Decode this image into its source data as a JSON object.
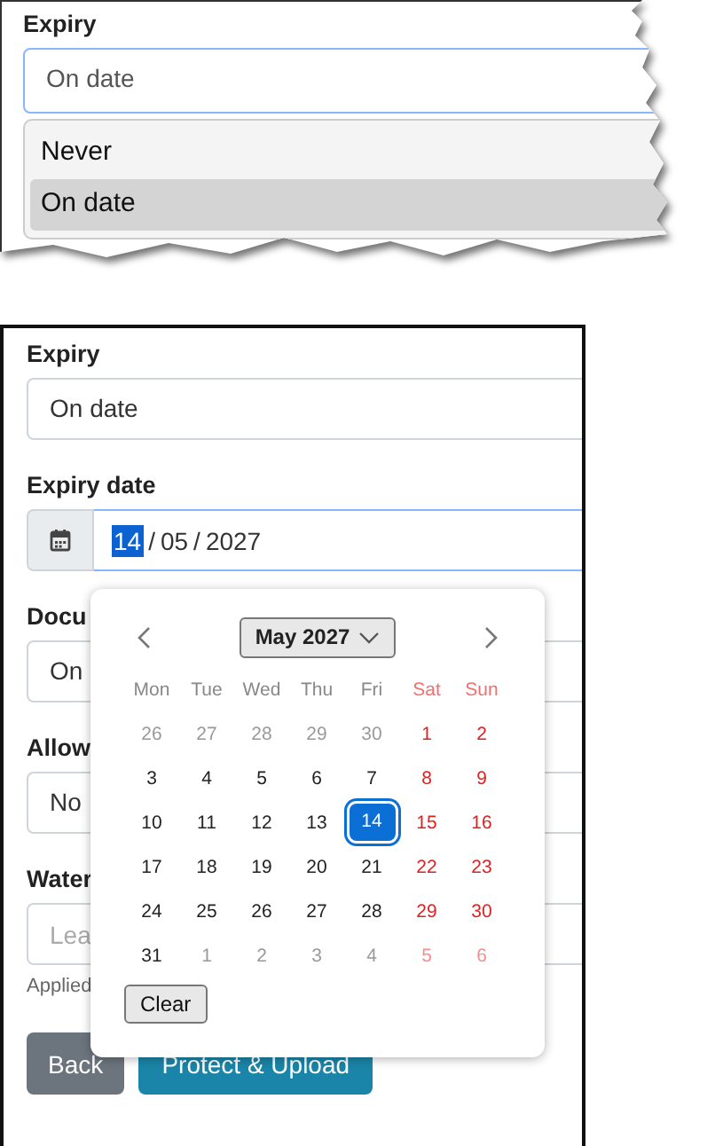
{
  "top_snippet": {
    "expiry_label": "Expiry",
    "expiry_select": {
      "value": "On date"
    },
    "dropdown_options": [
      {
        "label": "Never",
        "selected": false
      },
      {
        "label": "On date",
        "selected": true
      }
    ]
  },
  "form": {
    "expiry_label": "Expiry",
    "expiry_value": "On date",
    "expiry_date_label": "Expiry date",
    "expiry_date_segments": [
      {
        "text": "14",
        "selected": true
      },
      {
        "text": "/",
        "selected": false
      },
      {
        "text": "05",
        "selected": false
      },
      {
        "text": "/",
        "selected": false
      },
      {
        "text": "2027",
        "selected": false
      }
    ],
    "fields": [
      {
        "kind": "select",
        "label": "Docu",
        "value": "On"
      },
      {
        "kind": "select",
        "label": "Allow",
        "value": "No"
      },
      {
        "kind": "text",
        "label": "Water",
        "placeholder": "Lea",
        "help": "Applied"
      }
    ],
    "buttons": [
      {
        "kind": "secondary",
        "label": "Back"
      },
      {
        "kind": "primary",
        "label": "Protect & Upload"
      }
    ]
  },
  "calendar": {
    "month_label": "May 2027",
    "weekdays": [
      {
        "label": "Mon",
        "weekend": false
      },
      {
        "label": "Tue",
        "weekend": false
      },
      {
        "label": "Wed",
        "weekend": false
      },
      {
        "label": "Thu",
        "weekend": false
      },
      {
        "label": "Fri",
        "weekend": false
      },
      {
        "label": "Sat",
        "weekend": true
      },
      {
        "label": "Sun",
        "weekend": true
      }
    ],
    "weeks": [
      [
        {
          "day": "26",
          "outside": true,
          "weekend": false,
          "selected": false
        },
        {
          "day": "27",
          "outside": true,
          "weekend": false,
          "selected": false
        },
        {
          "day": "28",
          "outside": true,
          "weekend": false,
          "selected": false
        },
        {
          "day": "29",
          "outside": true,
          "weekend": false,
          "selected": false
        },
        {
          "day": "30",
          "outside": true,
          "weekend": false,
          "selected": false
        },
        {
          "day": "1",
          "outside": false,
          "weekend": true,
          "selected": false
        },
        {
          "day": "2",
          "outside": false,
          "weekend": true,
          "selected": false
        }
      ],
      [
        {
          "day": "3",
          "outside": false,
          "weekend": false,
          "selected": false
        },
        {
          "day": "4",
          "outside": false,
          "weekend": false,
          "selected": false
        },
        {
          "day": "5",
          "outside": false,
          "weekend": false,
          "selected": false
        },
        {
          "day": "6",
          "outside": false,
          "weekend": false,
          "selected": false
        },
        {
          "day": "7",
          "outside": false,
          "weekend": false,
          "selected": false
        },
        {
          "day": "8",
          "outside": false,
          "weekend": true,
          "selected": false
        },
        {
          "day": "9",
          "outside": false,
          "weekend": true,
          "selected": false
        }
      ],
      [
        {
          "day": "10",
          "outside": false,
          "weekend": false,
          "selected": false
        },
        {
          "day": "11",
          "outside": false,
          "weekend": false,
          "selected": false
        },
        {
          "day": "12",
          "outside": false,
          "weekend": false,
          "selected": false
        },
        {
          "day": "13",
          "outside": false,
          "weekend": false,
          "selected": false
        },
        {
          "day": "14",
          "outside": false,
          "weekend": false,
          "selected": true
        },
        {
          "day": "15",
          "outside": false,
          "weekend": true,
          "selected": false
        },
        {
          "day": "16",
          "outside": false,
          "weekend": true,
          "selected": false
        }
      ],
      [
        {
          "day": "17",
          "outside": false,
          "weekend": false,
          "selected": false
        },
        {
          "day": "18",
          "outside": false,
          "weekend": false,
          "selected": false
        },
        {
          "day": "19",
          "outside": false,
          "weekend": false,
          "selected": false
        },
        {
          "day": "20",
          "outside": false,
          "weekend": false,
          "selected": false
        },
        {
          "day": "21",
          "outside": false,
          "weekend": false,
          "selected": false
        },
        {
          "day": "22",
          "outside": false,
          "weekend": true,
          "selected": false
        },
        {
          "day": "23",
          "outside": false,
          "weekend": true,
          "selected": false
        }
      ],
      [
        {
          "day": "24",
          "outside": false,
          "weekend": false,
          "selected": false
        },
        {
          "day": "25",
          "outside": false,
          "weekend": false,
          "selected": false
        },
        {
          "day": "26",
          "outside": false,
          "weekend": false,
          "selected": false
        },
        {
          "day": "27",
          "outside": false,
          "weekend": false,
          "selected": false
        },
        {
          "day": "28",
          "outside": false,
          "weekend": false,
          "selected": false
        },
        {
          "day": "29",
          "outside": false,
          "weekend": true,
          "selected": false
        },
        {
          "day": "30",
          "outside": false,
          "weekend": true,
          "selected": false
        }
      ],
      [
        {
          "day": "31",
          "outside": false,
          "weekend": false,
          "selected": false
        },
        {
          "day": "1",
          "outside": true,
          "weekend": false,
          "selected": false
        },
        {
          "day": "2",
          "outside": true,
          "weekend": false,
          "selected": false
        },
        {
          "day": "3",
          "outside": true,
          "weekend": false,
          "selected": false
        },
        {
          "day": "4",
          "outside": true,
          "weekend": false,
          "selected": false
        },
        {
          "day": "5",
          "outside": true,
          "weekend": true,
          "selected": false
        },
        {
          "day": "6",
          "outside": true,
          "weekend": true,
          "selected": false
        }
      ]
    ],
    "clear_label": "Clear"
  }
}
